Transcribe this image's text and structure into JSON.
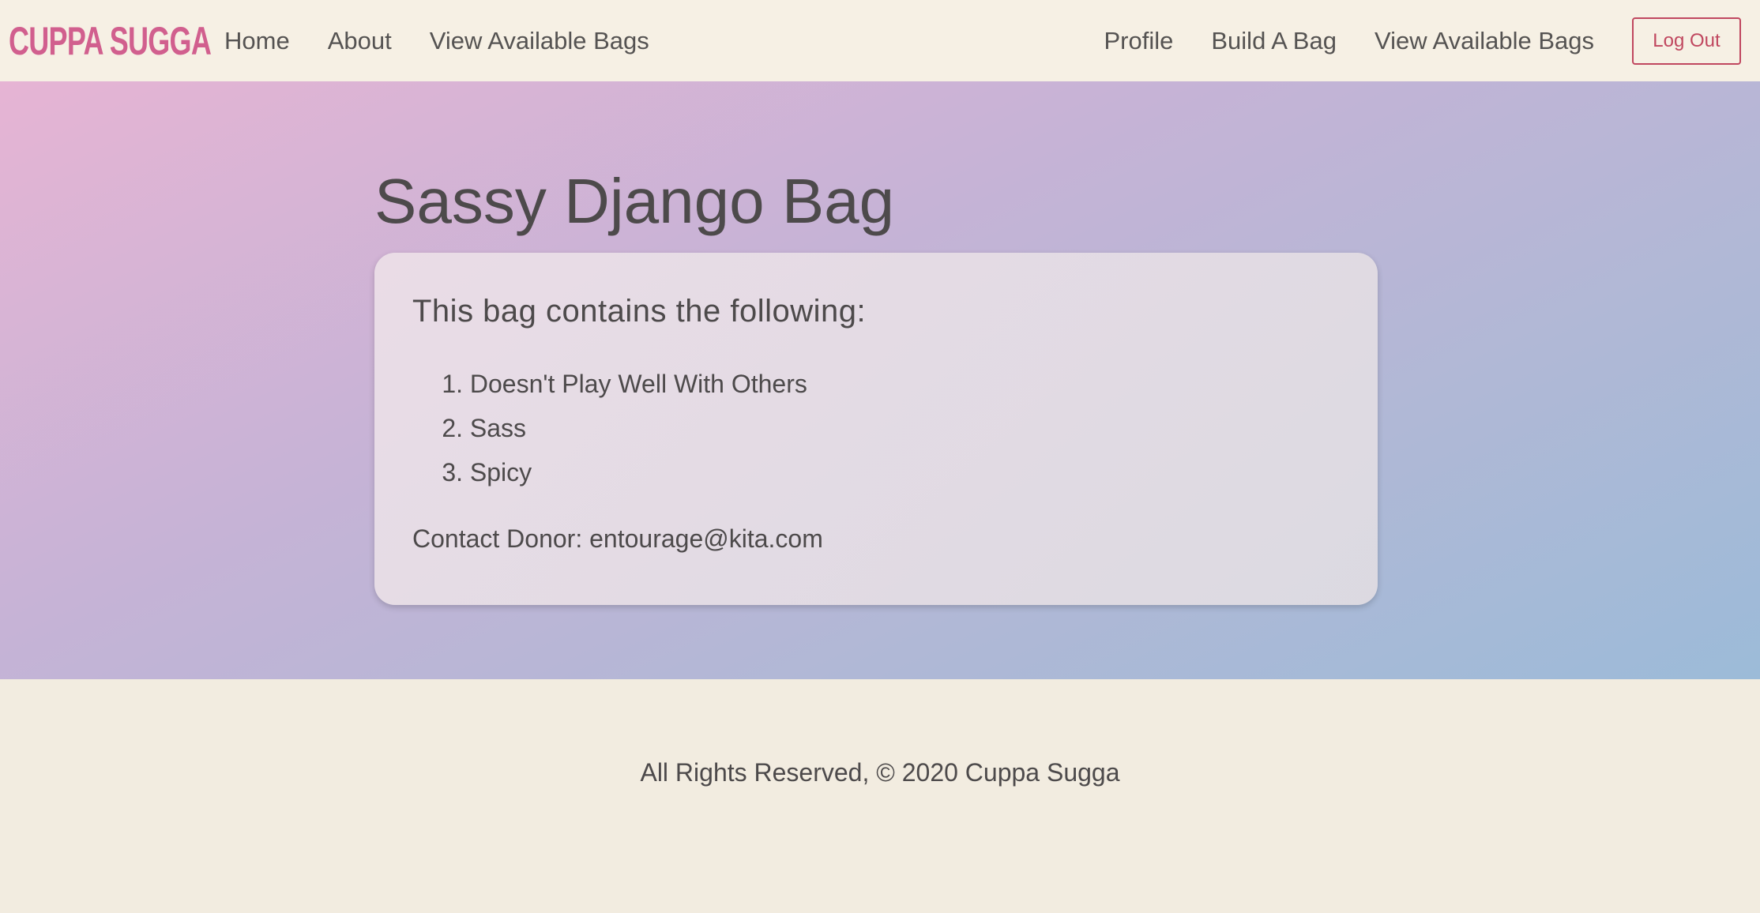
{
  "navbar": {
    "brand": "CUPPA SUGGA",
    "left_links": [
      "Home",
      "About",
      "View Available Bags"
    ],
    "right_links": [
      "Profile",
      "Build A Bag",
      "View Available Bags"
    ],
    "logout_label": "Log Out"
  },
  "main": {
    "title": "Sassy Django Bag",
    "card": {
      "heading": "This bag contains the following:",
      "items": [
        {
          "num": "1.",
          "label": "Doesn't Play Well With Others"
        },
        {
          "num": "2.",
          "label": "Sass"
        },
        {
          "num": "3.",
          "label": "Spicy"
        }
      ],
      "contact": "Contact Donor: entourage@kita.com"
    }
  },
  "footer": {
    "text": "All Rights Reserved, © 2020 Cuppa Sugga"
  },
  "colors": {
    "brand": "#d15f8e",
    "logout": "#c0475f",
    "navbar_bg": "#f6f0e4",
    "footer_bg": "#f2ece0",
    "text": "#4d4a4b"
  }
}
